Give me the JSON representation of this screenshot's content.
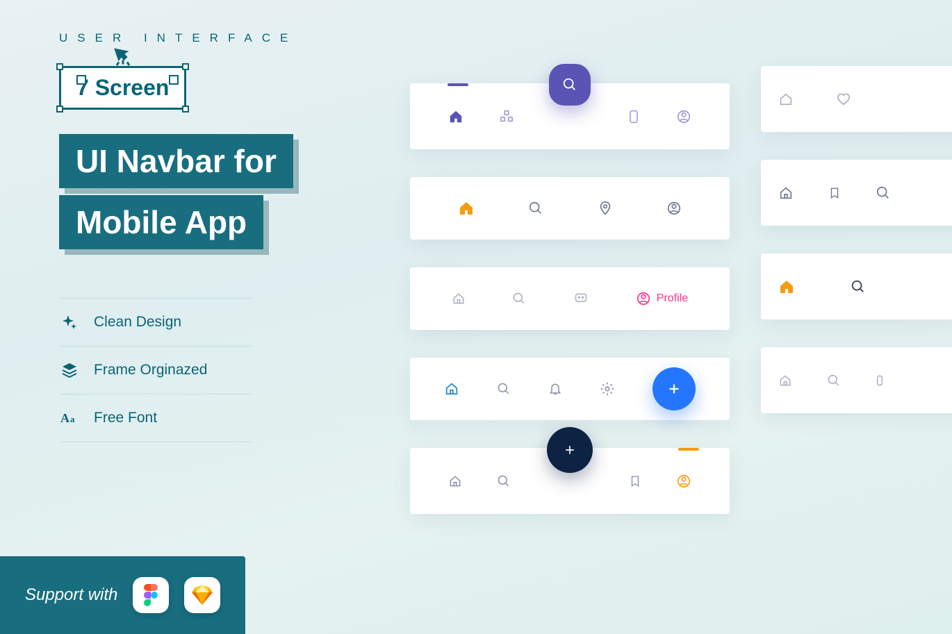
{
  "eyebrow": "USER INTERFACE",
  "badge": "7 Screen",
  "title_line1": "UI Navbar for",
  "title_line2": "Mobile App",
  "features": {
    "clean": "Clean Design",
    "frame": "Frame Orginazed",
    "font": "Free Font"
  },
  "support_label": "Support with",
  "nav3_profile": "Profile"
}
